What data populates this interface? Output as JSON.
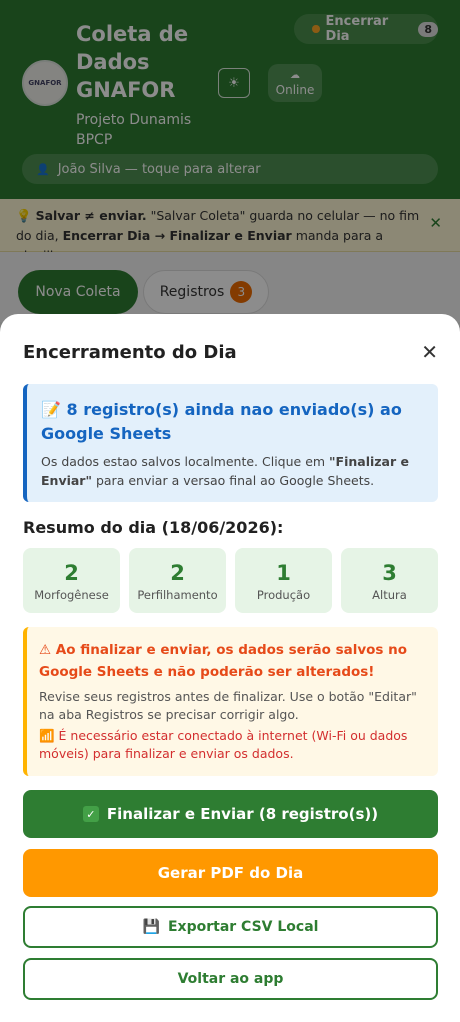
{
  "header": {
    "logo_text": "GNAFOR",
    "title": "Coleta de Dados GNAFOR",
    "subtitle": "Projeto Dunamis BPCP",
    "theme_icon": "sun-icon",
    "online_label": "Online",
    "end_day_label": "Encerrar Dia",
    "end_day_count": "8",
    "user_text": "João Silva — toque para alterar"
  },
  "tip": {
    "strong1": "Salvar ≠ enviar.",
    "text1": " \"Salvar Coleta\" guarda no celular — no fim do dia, ",
    "strong2": "Encerrar Dia → Finalizar e Enviar",
    "text2": " manda para a planilha.",
    "close": "✕"
  },
  "tabs": {
    "new_label": "Nova Coleta",
    "records_label": "Registros",
    "records_count": "3"
  },
  "modal": {
    "title": "Encerramento do Dia",
    "close": "✕",
    "info": {
      "heading": "8 registro(s) ainda nao enviado(s) ao Google Sheets",
      "text_pre": "Os dados estao salvos localmente. Clique em ",
      "text_bold": "\"Finalizar e Enviar\"",
      "text_post": " para enviar a versao final ao Google Sheets."
    },
    "summary_title": "Resumo do dia (18/06/2026):",
    "stats": [
      {
        "value": "2",
        "label": "Morfogênese"
      },
      {
        "value": "2",
        "label": "Perfilhamento"
      },
      {
        "value": "1",
        "label": "Produção"
      },
      {
        "value": "3",
        "label": "Altura"
      }
    ],
    "warning": {
      "heading": "⚠ Ao finalizar e enviar, os dados serão salvos no Google Sheets e não poderão ser alterados!",
      "text": "Revise seus registros antes de finalizar. Use o botão \"Editar\" na aba Registros se precisar corrigir algo.",
      "network": "📶 É necessário estar conectado à internet (Wi-Fi ou dados móveis) para finalizar e enviar os dados."
    },
    "buttons": {
      "finalize": "Finalizar e Enviar (8 registro(s))",
      "pdf": "Gerar PDF do Dia",
      "csv": "Exportar CSV Local",
      "back": "Voltar ao app"
    }
  },
  "colors": {
    "primary_green": "#2e7d32",
    "info_blue": "#1565c0",
    "warning_orange": "#ff9800",
    "danger_red": "#d32f2f"
  }
}
